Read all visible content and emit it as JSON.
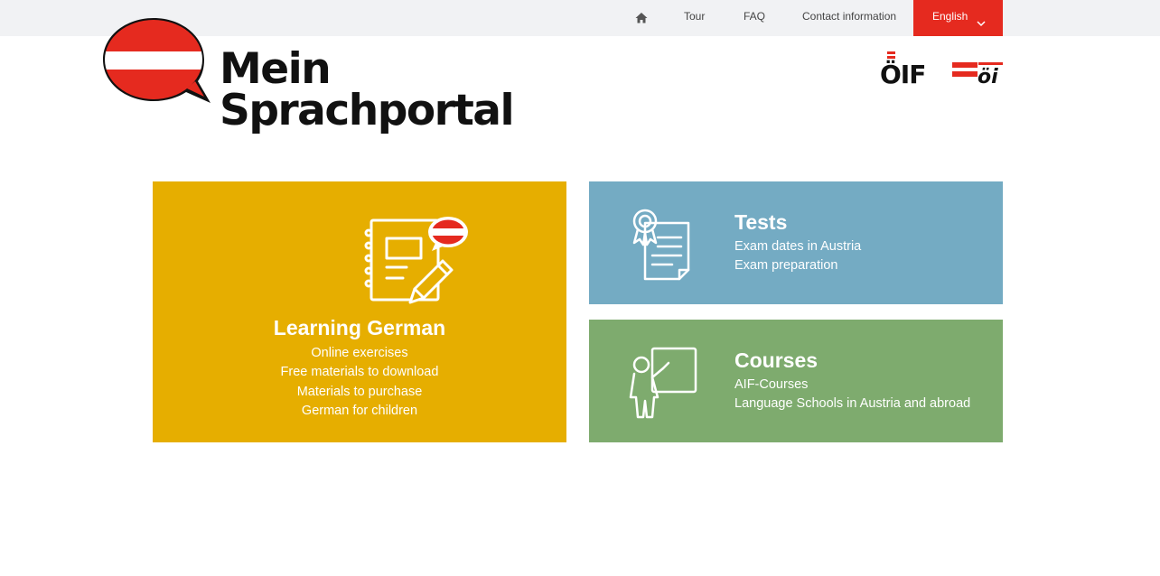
{
  "topnav": {
    "home_icon": "home-icon",
    "tour": "Tour",
    "faq": "FAQ",
    "contact": "Contact information",
    "language": "English",
    "language_icon": "chevron-down-icon"
  },
  "logo": {
    "line1": "Mein",
    "line2": "Sprachportal",
    "flag_colors": {
      "red": "#e52a1f",
      "white": "#ffffff",
      "outline": "#111111"
    }
  },
  "partners": {
    "oif_text": "ÖIF",
    "oi_text": "öi"
  },
  "tiles": {
    "learning": {
      "title": "Learning German",
      "items": [
        "Online exercises",
        "Free materials to download",
        "Materials to purchase",
        "German for children"
      ],
      "icon": "notebook-pencil-icon",
      "color": "#e6ae00"
    },
    "tests": {
      "title": "Tests",
      "items": [
        "Exam dates in Austria",
        "Exam preparation"
      ],
      "icon": "certificate-icon",
      "color": "#74abc3"
    },
    "courses": {
      "title": "Courses",
      "items": [
        "AIF-Courses",
        "Language Schools in Austria and abroad"
      ],
      "icon": "teacher-board-icon",
      "color": "#7eab6e"
    }
  }
}
